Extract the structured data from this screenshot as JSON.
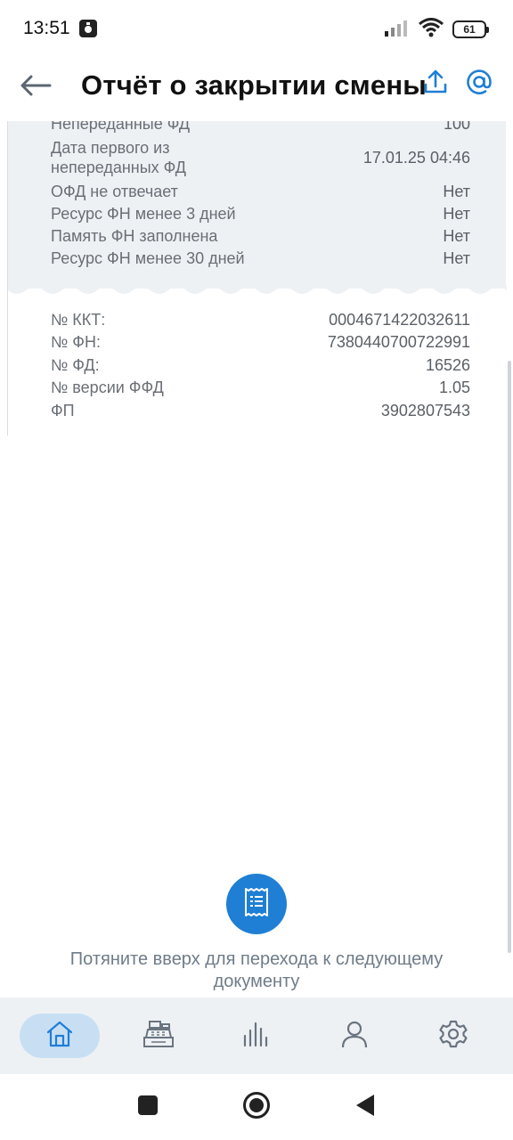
{
  "status_bar": {
    "time": "13:51",
    "battery": "61",
    "icons": [
      "app-notification-icon",
      "signal-icon",
      "wifi-icon",
      "battery-icon"
    ]
  },
  "app_bar": {
    "title": "Отчёт о закрытии смены",
    "icons": [
      "back-arrow-icon",
      "share-upload-icon",
      "at-sign-icon"
    ]
  },
  "receipt": {
    "top_rows": [
      {
        "label": "Непереданные ФД",
        "value": "100"
      },
      {
        "label": "Дата первого из\nнепереданных ФД",
        "value": "17.01.25 04:46"
      },
      {
        "label": "ОФД не отвечает",
        "value": "Нет"
      },
      {
        "label": "Ресурс ФН менее 3 дней",
        "value": "Нет"
      },
      {
        "label": "Память ФН заполнена",
        "value": "Нет"
      },
      {
        "label": "Ресурс ФН менее 30 дней",
        "value": "Нет"
      }
    ],
    "bottom_rows": [
      {
        "label": "№ ККТ:",
        "value": "0004671422032611"
      },
      {
        "label": "№ ФН:",
        "value": "7380440700722991"
      },
      {
        "label": "№ ФД:",
        "value": "16526"
      },
      {
        "label": "№ версии ФФД",
        "value": "1.05"
      },
      {
        "label": "ФП",
        "value": "3902807543"
      }
    ]
  },
  "pull_up": {
    "text": "Потяните вверх для перехода к следующему документу",
    "icon": "receipt-icon"
  },
  "bottom_nav": {
    "items": [
      {
        "name": "home",
        "icon": "home-icon",
        "active": true
      },
      {
        "name": "cash-register",
        "icon": "cash-register-icon",
        "active": false
      },
      {
        "name": "reports",
        "icon": "bar-chart-icon",
        "active": false
      },
      {
        "name": "profile",
        "icon": "person-icon",
        "active": false
      },
      {
        "name": "settings",
        "icon": "gear-icon",
        "active": false
      }
    ]
  },
  "colors": {
    "accent": "#1f7fd4",
    "receipt_bg": "#eef1f4",
    "nav_active_bg": "#c8dff3",
    "muted_text": "#6f7c89"
  }
}
